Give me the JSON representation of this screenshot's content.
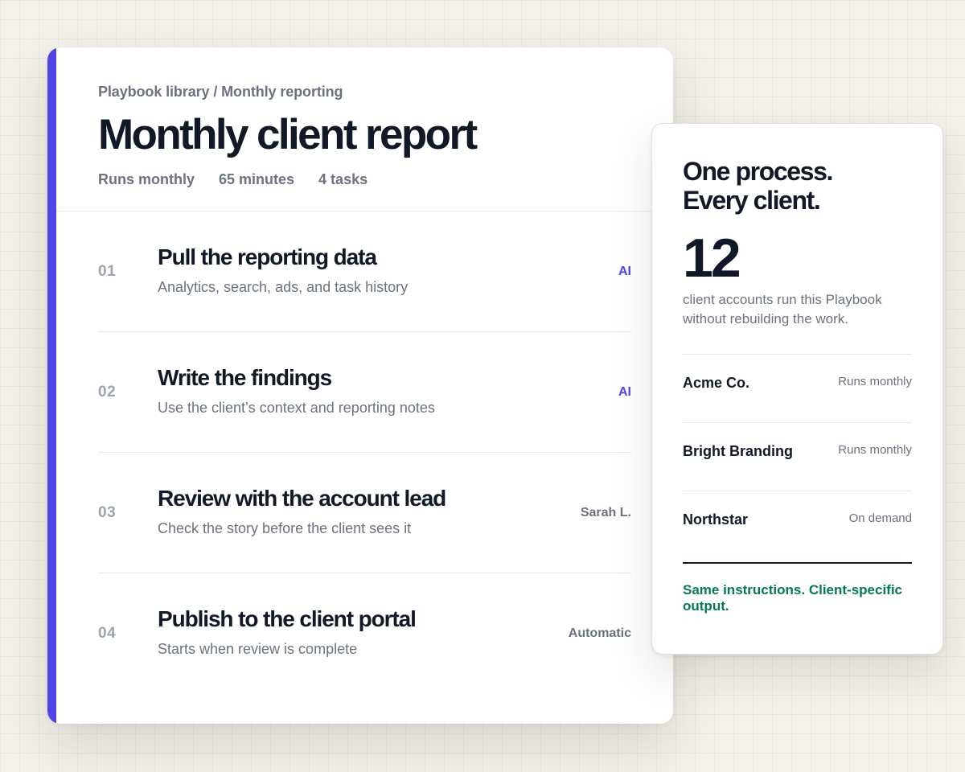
{
  "colors": {
    "accent": "#4f46e5",
    "success": "#047857",
    "background": "#f3f1ea"
  },
  "playbook": {
    "breadcrumb": "Playbook library / Monthly reporting",
    "title": "Monthly client report",
    "meta": {
      "frequency": "Runs monthly",
      "duration": "65 minutes",
      "task_count": "4 tasks"
    },
    "tasks": [
      {
        "number": "01",
        "title": "Pull the reporting data",
        "description": "Analytics, search, ads, and task history",
        "owner": "AI"
      },
      {
        "number": "02",
        "title": "Write the findings",
        "description": "Use the client’s context and reporting notes",
        "owner": "AI"
      },
      {
        "number": "03",
        "title": "Review with the account lead",
        "description": "Check the story before the client sees it",
        "owner": "Sarah L."
      },
      {
        "number": "04",
        "title": "Publish to the client portal",
        "description": "Starts when review is complete",
        "owner": "Automatic"
      }
    ]
  },
  "summary": {
    "heading_line1": "One process.",
    "heading_line2": "Every client.",
    "client_count": "12",
    "caption": "client accounts run this Playbook without rebuilding the work.",
    "clients": [
      {
        "name": "Acme Co.",
        "status": "Runs monthly"
      },
      {
        "name": "Bright Branding",
        "status": "Runs monthly"
      },
      {
        "name": "Northstar",
        "status": "On demand"
      }
    ],
    "footer": "Same instructions. Client-specific output."
  }
}
